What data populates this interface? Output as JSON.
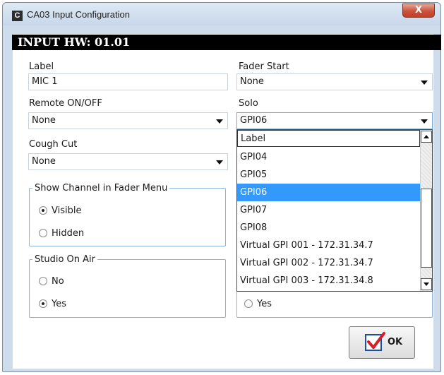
{
  "window": {
    "title": "CA03 Input Configuration",
    "app_icon_letter": "C",
    "close_glyph": "X"
  },
  "header": {
    "title": "INPUT HW: 01.01"
  },
  "left": {
    "label": {
      "caption": "Label",
      "value": "MIC 1"
    },
    "remote": {
      "caption": "Remote ON/OFF",
      "value": "None"
    },
    "cough": {
      "caption": "Cough Cut",
      "value": "None"
    },
    "show_channel": {
      "legend": "Show Channel in Fader Menu",
      "options": [
        {
          "label": "Visible",
          "selected": true
        },
        {
          "label": "Hidden",
          "selected": false
        }
      ]
    },
    "studio_on_air": {
      "legend": "Studio On Air",
      "options": [
        {
          "label": "No",
          "selected": false
        },
        {
          "label": "Yes",
          "selected": true
        }
      ]
    }
  },
  "right": {
    "fader_start": {
      "caption": "Fader Start",
      "value": "None"
    },
    "solo": {
      "caption": "Solo",
      "value": "GPI06",
      "list": [
        "Label",
        "GPI04",
        "GPI05",
        "GPI06",
        "GPI07",
        "GPI08",
        "Virtual GPI 001 - 172.31.34.7",
        "Virtual GPI 002 - 172.31.34.7",
        "Virtual GPI 003 - 172.31.34.8"
      ],
      "selected_index": 3
    },
    "hidden_yes": {
      "label": "Yes"
    }
  },
  "buttons": {
    "ok_label": "OK"
  },
  "colors": {
    "selection": "#3399ff",
    "header_bg": "#000000",
    "window_frame": "#cfdcec",
    "ok_check": "#d4202a"
  }
}
